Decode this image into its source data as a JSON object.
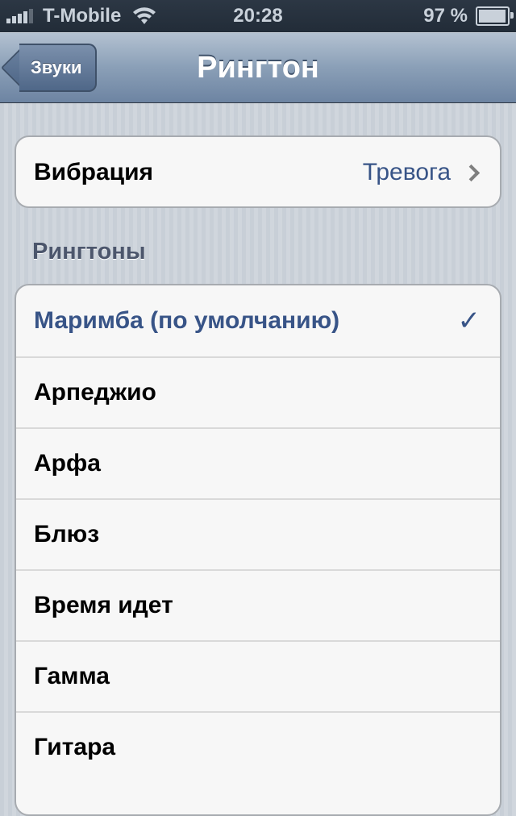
{
  "status_bar": {
    "carrier": "T-Mobile",
    "time": "20:28",
    "battery_percent": "97 %",
    "battery_level": 0.97,
    "signal_bars": 4,
    "wifi": "wifi-icon"
  },
  "navbar": {
    "back_label": "Звуки",
    "title": "Рингтон"
  },
  "vibration": {
    "label": "Вибрация",
    "value": "Тревога",
    "icon": "chevron-right-icon"
  },
  "ringtones": {
    "header": "Рингтоны",
    "selected_icon": "checkmark-icon",
    "items": [
      {
        "label": "Маримба (по умолчанию)",
        "selected": true
      },
      {
        "label": "Арпеджио",
        "selected": false
      },
      {
        "label": "Арфа",
        "selected": false
      },
      {
        "label": "Блюз",
        "selected": false
      },
      {
        "label": "Время идет",
        "selected": false
      },
      {
        "label": "Гамма",
        "selected": false
      },
      {
        "label": "Гитара",
        "selected": false
      }
    ]
  },
  "colors": {
    "accent": "#385487",
    "navbar": "#6d84a2",
    "background": "#c5ccd4"
  }
}
